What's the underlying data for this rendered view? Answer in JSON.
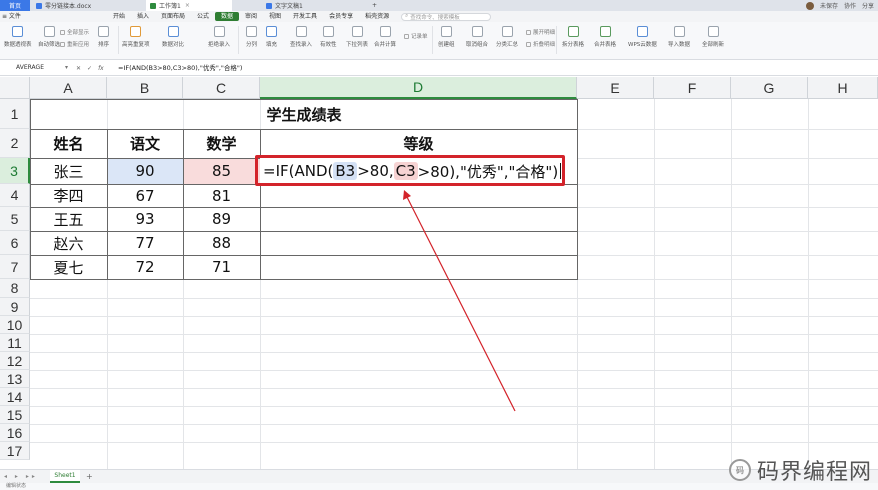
{
  "titlebar": {
    "tabs": [
      {
        "label": "首页",
        "type": "home"
      },
      {
        "label": "零分链接本.docx",
        "type": "doc"
      },
      {
        "label": "工作簿1",
        "type": "sheet",
        "active": true
      },
      {
        "label": "文字文稿1",
        "type": "doc"
      }
    ],
    "add": "+",
    "right": [
      "未保存",
      "协作",
      "分享"
    ]
  },
  "menubar": {
    "items": [
      "≡ 文件",
      "开始",
      "插入",
      "页面布局",
      "公式",
      "数据",
      "审阅",
      "视图",
      "开发工具",
      "会员专享",
      "稻壳资源"
    ],
    "active": "数据",
    "search_placeholder": "查找命令、搜索模板"
  },
  "ribbon": {
    "buttons": [
      "数据透视表",
      "自动筛选",
      "全部显示",
      "重新应用",
      "排序",
      "高亮重复项",
      "数据对比",
      "拒绝录入",
      "分列",
      "填充",
      "查找录入",
      "有效性",
      "下拉列表",
      "合并计算",
      "记录单",
      "创建组",
      "取消组合",
      "分类汇总",
      "展开明细",
      "折叠明细",
      "拆分表格",
      "合并表格",
      "WPS云数据",
      "导入数据",
      "全部刷新"
    ]
  },
  "formula_bar": {
    "name_box": "AVERAGE",
    "icons": [
      "✕",
      "✓",
      "fx"
    ],
    "formula": "=IF(AND(B3>80,C3>80),\"优秀\",\"合格\")"
  },
  "columns": [
    "A",
    "B",
    "C",
    "D",
    "E",
    "F",
    "G",
    "H"
  ],
  "rows": [
    "1",
    "2",
    "3",
    "4",
    "5",
    "6",
    "7",
    "8",
    "9",
    "10",
    "11",
    "12",
    "13",
    "14",
    "15",
    "16",
    "17"
  ],
  "table": {
    "title": "学生成绩表",
    "headers": [
      "姓名",
      "语文",
      "数学",
      "等级"
    ],
    "data": [
      [
        "张三",
        "90",
        "85"
      ],
      [
        "李四",
        "67",
        "81"
      ],
      [
        "王五",
        "93",
        "89"
      ],
      [
        "赵六",
        "77",
        "88"
      ],
      [
        "夏七",
        "72",
        "71"
      ]
    ]
  },
  "editing_cell": {
    "prefix": "=IF(AND(",
    "ref1": "B3",
    "mid": ">80,",
    "ref2": "C3",
    "suffix": ">80),\"优秀\",\"合格\")"
  },
  "sheetbar": {
    "nav": "◂ ▸ ▸▸",
    "active_sheet": "Sheet1",
    "add": "+",
    "status": "编辑状态"
  },
  "watermark": {
    "badge": "码",
    "text": "码界编程网"
  },
  "colors": {
    "accent": "#2e7d32",
    "highlight_red": "#d3232a",
    "ref_blue": "#d4e1f5",
    "ref_red": "#f6d3d3"
  }
}
